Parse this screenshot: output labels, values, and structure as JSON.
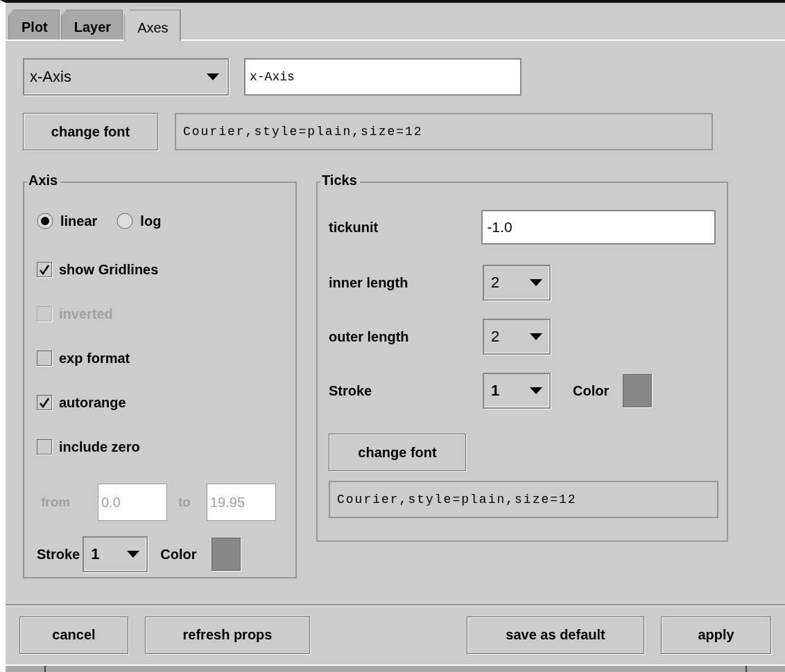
{
  "tabs": [
    {
      "label": "Plot",
      "selected": false
    },
    {
      "label": "Layer",
      "selected": false
    },
    {
      "label": "Axes",
      "selected": true
    }
  ],
  "axis_select": {
    "value": "x-Axis"
  },
  "axis_title": {
    "value": "x-Axis"
  },
  "font_button": "change font",
  "font_display": "Courier,style=plain,size=12",
  "axis_group": {
    "title": "Axis",
    "scale": [
      {
        "label": "linear",
        "selected": true
      },
      {
        "label": "log",
        "selected": false
      }
    ],
    "options": [
      {
        "label": "show Gridlines",
        "checked": true,
        "disabled": false
      },
      {
        "label": "inverted",
        "checked": false,
        "disabled": true
      },
      {
        "label": "exp format",
        "checked": false,
        "disabled": false
      },
      {
        "label": "autorange",
        "checked": true,
        "disabled": false
      },
      {
        "label": "include zero",
        "checked": false,
        "disabled": false
      }
    ],
    "range": {
      "disabled": true,
      "from_label": "from",
      "from_value": "0.0",
      "to_label": "to",
      "to_value": "19.95"
    },
    "stroke": {
      "label": "Stroke",
      "value": "1"
    },
    "color": {
      "label": "Color",
      "color": "#888888"
    }
  },
  "ticks_group": {
    "title": "Ticks",
    "tickunit": {
      "label": "tickunit",
      "value": "-1.0"
    },
    "inner_length": {
      "label": "inner length",
      "value": "2"
    },
    "outer_length": {
      "label": "outer length",
      "value": "2"
    },
    "stroke": {
      "label": "Stroke",
      "value": "1"
    },
    "color": {
      "label": "Color",
      "color": "#888888"
    },
    "font_button": "change font",
    "font_display": "Courier,style=plain,size=12"
  },
  "buttons": [
    {
      "label": "cancel"
    },
    {
      "label": "refresh props"
    },
    {
      "label": "save as default"
    },
    {
      "label": "apply"
    }
  ]
}
